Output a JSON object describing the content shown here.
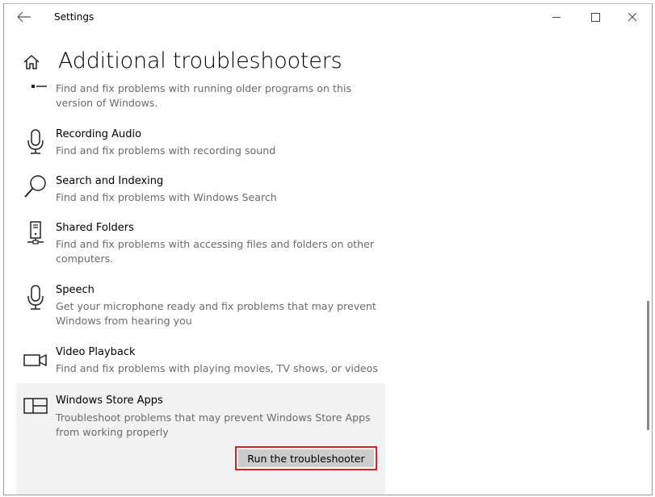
{
  "window": {
    "title": "Settings"
  },
  "header": {
    "title": "Additional troubleshooters"
  },
  "items": [
    {
      "icon": "compatibility-icon",
      "name": "",
      "description": "Find and fix problems with running older programs on this version of Windows."
    },
    {
      "icon": "microphone-icon",
      "name": "Recording Audio",
      "description": "Find and fix problems with recording sound"
    },
    {
      "icon": "search-icon",
      "name": "Search and Indexing",
      "description": "Find and fix problems with Windows Search"
    },
    {
      "icon": "shared-folders-icon",
      "name": "Shared Folders",
      "description": "Find and fix problems with accessing files and folders on other computers."
    },
    {
      "icon": "microphone-icon",
      "name": "Speech",
      "description": "Get your microphone ready and fix problems that may prevent Windows from hearing you"
    },
    {
      "icon": "video-camera-icon",
      "name": "Video Playback",
      "description": "Find and fix problems with playing movies, TV shows, or videos"
    },
    {
      "icon": "store-apps-icon",
      "name": "Windows Store Apps",
      "description": "Troubleshoot problems that may prevent Windows Store Apps from working properly",
      "selected": true,
      "button_label": "Run the troubleshooter"
    }
  ],
  "colors": {
    "selected_bg": "#f2f2f2",
    "button_bg": "#cccccc",
    "highlight_border": "#e02020",
    "description_text": "#6b6b6b"
  }
}
